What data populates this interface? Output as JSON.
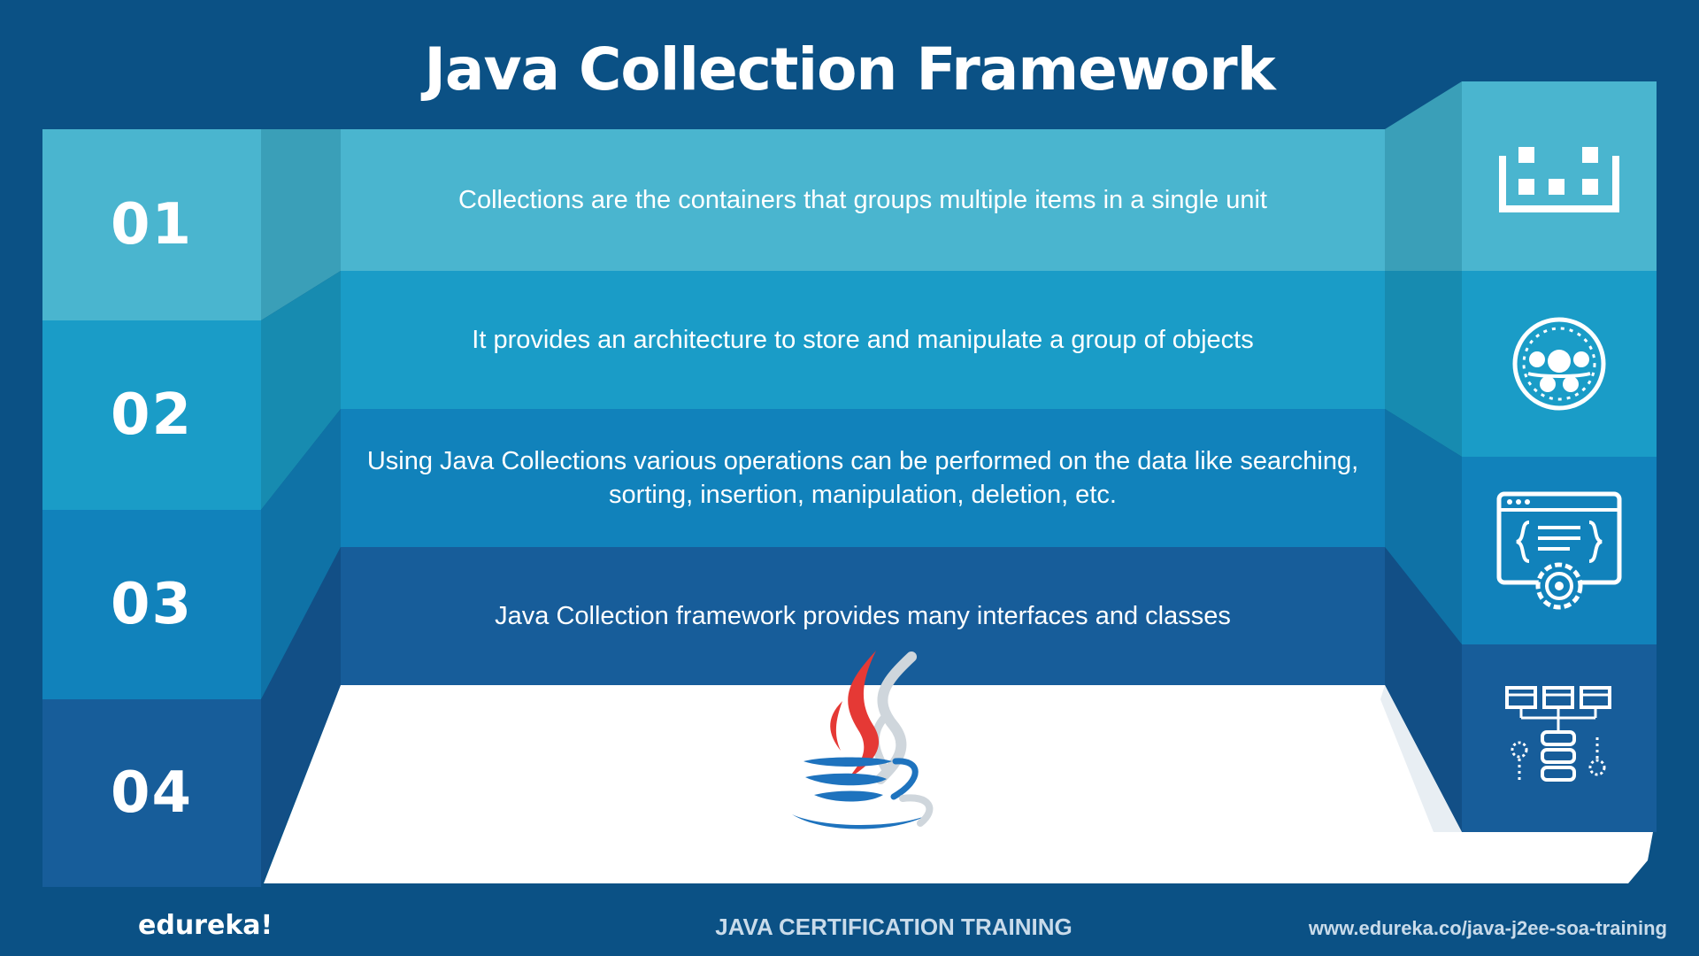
{
  "slide": {
    "title": "Java Collection Framework"
  },
  "rows": [
    {
      "number": "01",
      "text": "Collections are the containers that groups multiple items in a single unit",
      "icon": "grid-blocks-icon"
    },
    {
      "number": "02",
      "text": "It provides an architecture to store and manipulate a group of objects",
      "icon": "gear-network-icon"
    },
    {
      "number": "03",
      "text": "Using Java Collections various operations can be performed on the data like searching, sorting, insertion, manipulation, deletion, etc.",
      "icon": "code-window-gear-icon"
    },
    {
      "number": "04",
      "text": "Java Collection framework provides many interfaces and classes",
      "icon": "database-hierarchy-icon"
    }
  ],
  "center_graphic": "java-logo-icon",
  "footer": {
    "brand": "edureka!",
    "course": "JAVA CERTIFICATION TRAINING",
    "url": "www.edureka.co/java-j2ee-soa-training"
  },
  "colors": {
    "background": "#0b5185",
    "row1": "#4ab5cf",
    "row2": "#1a9cc7",
    "row3": "#1182bb",
    "row4": "#175d9a",
    "floor": "#ffffff",
    "java_red": "#e53935",
    "java_blue": "#1e73be"
  }
}
